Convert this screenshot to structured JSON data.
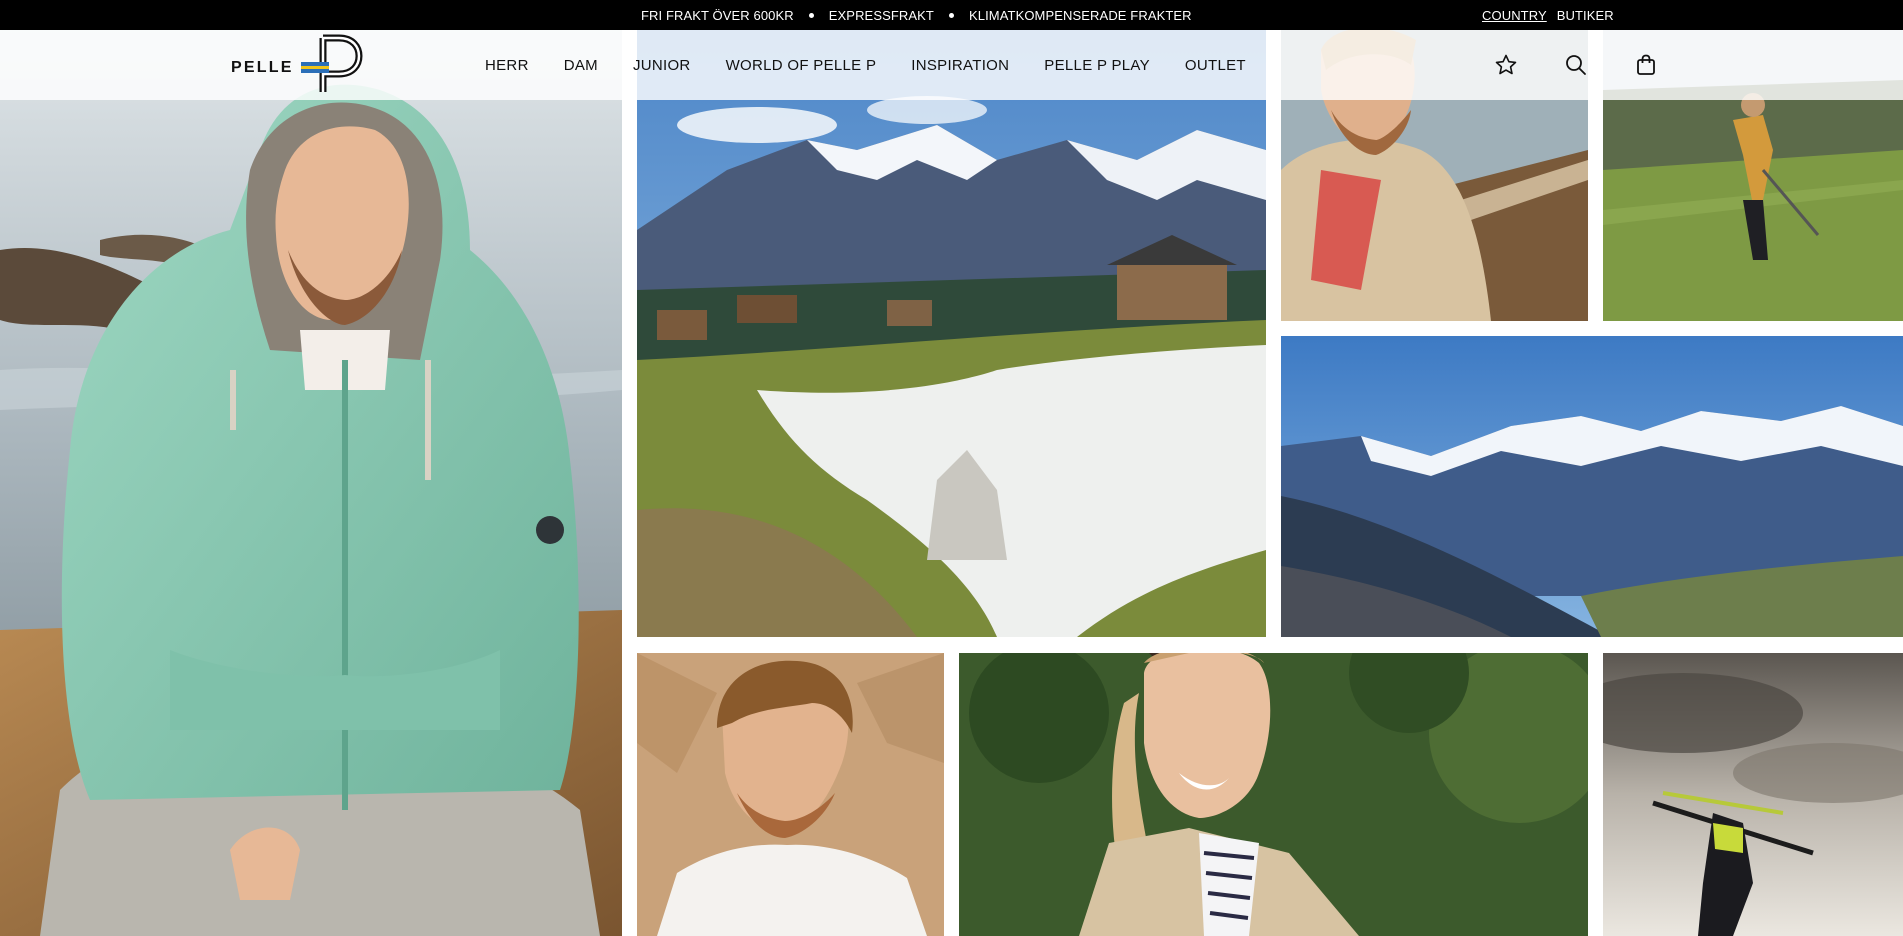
{
  "announcement": {
    "messages": [
      "FRI FRAKT ÖVER 600KR",
      "EXPRESSFRAKT",
      "KLIMATKOMPENSERADE FRAKTER"
    ],
    "links": [
      {
        "label": "COUNTRY"
      },
      {
        "label": "BUTIKER"
      }
    ]
  },
  "header": {
    "logo_text": "PELLE",
    "logo_mark": "P",
    "nav": [
      "HERR",
      "DAM",
      "JUNIOR",
      "WORLD OF PELLE P",
      "INSPIRATION",
      "PELLE P PLAY",
      "OUTLET"
    ],
    "icons": [
      "star-icon",
      "search-icon",
      "shopping-bag-icon"
    ]
  },
  "gallery": {
    "tiles": [
      {
        "subject": "man in mint hoodie by the sea"
      },
      {
        "subject": "mountain village with melting snow"
      },
      {
        "subject": "man in beige jacket on boardwalk"
      },
      {
        "subject": "golfer teeing off"
      },
      {
        "subject": "snowy alpine panorama"
      },
      {
        "subject": "curly haired man in white t-shirt"
      },
      {
        "subject": "smiling woman in beige jacket"
      },
      {
        "subject": "freestyle skier in the air"
      }
    ]
  },
  "colors": {
    "topbar": "#000000",
    "header_bg": "#ffffff",
    "text": "#111111",
    "hoodie": "#86c9b2",
    "sky": "#3f7cc4",
    "grass": "#7d8b3a"
  }
}
